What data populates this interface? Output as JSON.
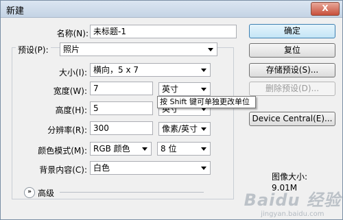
{
  "window": {
    "title": "新建",
    "close_label": "X"
  },
  "form": {
    "name": {
      "label": "名称(N):",
      "value": "未标题-1"
    },
    "preset": {
      "label": "预设(P):",
      "value": "照片"
    },
    "size": {
      "label": "大小(I):",
      "value": "横向，5 x 7"
    },
    "width": {
      "label": "宽度(W):",
      "value": "7",
      "unit": "英寸"
    },
    "height": {
      "label": "高度(H):",
      "value": "5",
      "unit": "英寸"
    },
    "resolution": {
      "label": "分辨率(R):",
      "value": "300",
      "unit": "像素/英寸"
    },
    "color_mode": {
      "label": "颜色模式(M):",
      "value": "RGB 颜色",
      "depth": "8 位"
    },
    "background": {
      "label": "背景内容(C):",
      "value": "白色"
    },
    "advanced_label": "高级"
  },
  "tooltip": "按 Shift 键可单独更改单位",
  "buttons": {
    "ok": "确定",
    "reset": "复位",
    "save_preset": "存储预设(S)...",
    "delete_preset": "删除预设(D)...",
    "device_central": "Device Central(E)..."
  },
  "image_size": {
    "label": "图像大小:",
    "value": "9.01M"
  },
  "watermark": {
    "text": "Baidu 经验",
    "url": "jingyan.baidu.com"
  }
}
